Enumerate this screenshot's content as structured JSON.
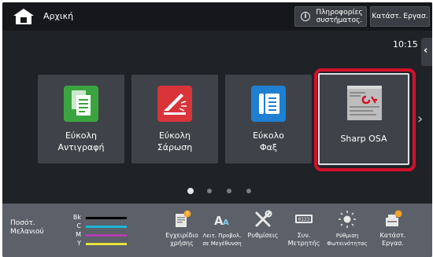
{
  "topbar": {
    "home_icon": "home-icon",
    "title": "Αρχική",
    "info_icon": "info-icon",
    "info_button_label_line1": "Πληροφορίες",
    "info_button_label_line2": "συστήματος.",
    "job_status_button_label": "Κατάστ. Εργασ."
  },
  "clock": "10:15",
  "side_tab_icon": "chevron-left-icon",
  "tiles": [
    {
      "line1": "Εύκολη",
      "line2": "Αντιγραφή",
      "icon": "copy-icon",
      "color": "#3aa53f"
    },
    {
      "line1": "Εύκολη",
      "line2": "Σάρωση",
      "icon": "scanner-icon",
      "color": "#d8343a"
    },
    {
      "line1": "Εύκολο",
      "line2": "Φαξ",
      "icon": "fax-icon",
      "color": "#1f7fd1"
    },
    {
      "line1": "Sharp OSA",
      "line2": "",
      "icon": "sharp-osa-icon",
      "color": "#b9b9b9",
      "selected": true
    }
  ],
  "page_indicator": {
    "current": 1,
    "total": 4
  },
  "toner": {
    "label_line1": "Ποσότ.",
    "label_line2": "Μελανιού",
    "rows": [
      {
        "name": "Bk",
        "color": "#000000",
        "level": 1.0
      },
      {
        "name": "C",
        "color": "#1bb6d8",
        "level": 1.0
      },
      {
        "name": "M",
        "color": "#b43fb0",
        "level": 1.0
      },
      {
        "name": "Y",
        "color": "#e8e23a",
        "level": 1.0
      }
    ]
  },
  "functions": [
    {
      "line1": "Εγχειρίδιο",
      "line2": "χρήσης",
      "icon": "manual-icon"
    },
    {
      "line1": "Λειτ. Προβολ.",
      "line2": "σε Μεγέθυνση",
      "icon": "enlarge-text-icon"
    },
    {
      "line1": "Ρυθμίσεις",
      "line2": "",
      "icon": "settings-tools-icon"
    },
    {
      "line1": "Συν.",
      "line2": "Μετρητής",
      "icon": "counter-icon"
    },
    {
      "line1": "Ρύθμιση",
      "line2": "Φωτεινότητας",
      "icon": "brightness-icon"
    },
    {
      "line1": "Κατάστ.",
      "line2": "Εργασ.",
      "icon": "job-status-icon"
    }
  ]
}
